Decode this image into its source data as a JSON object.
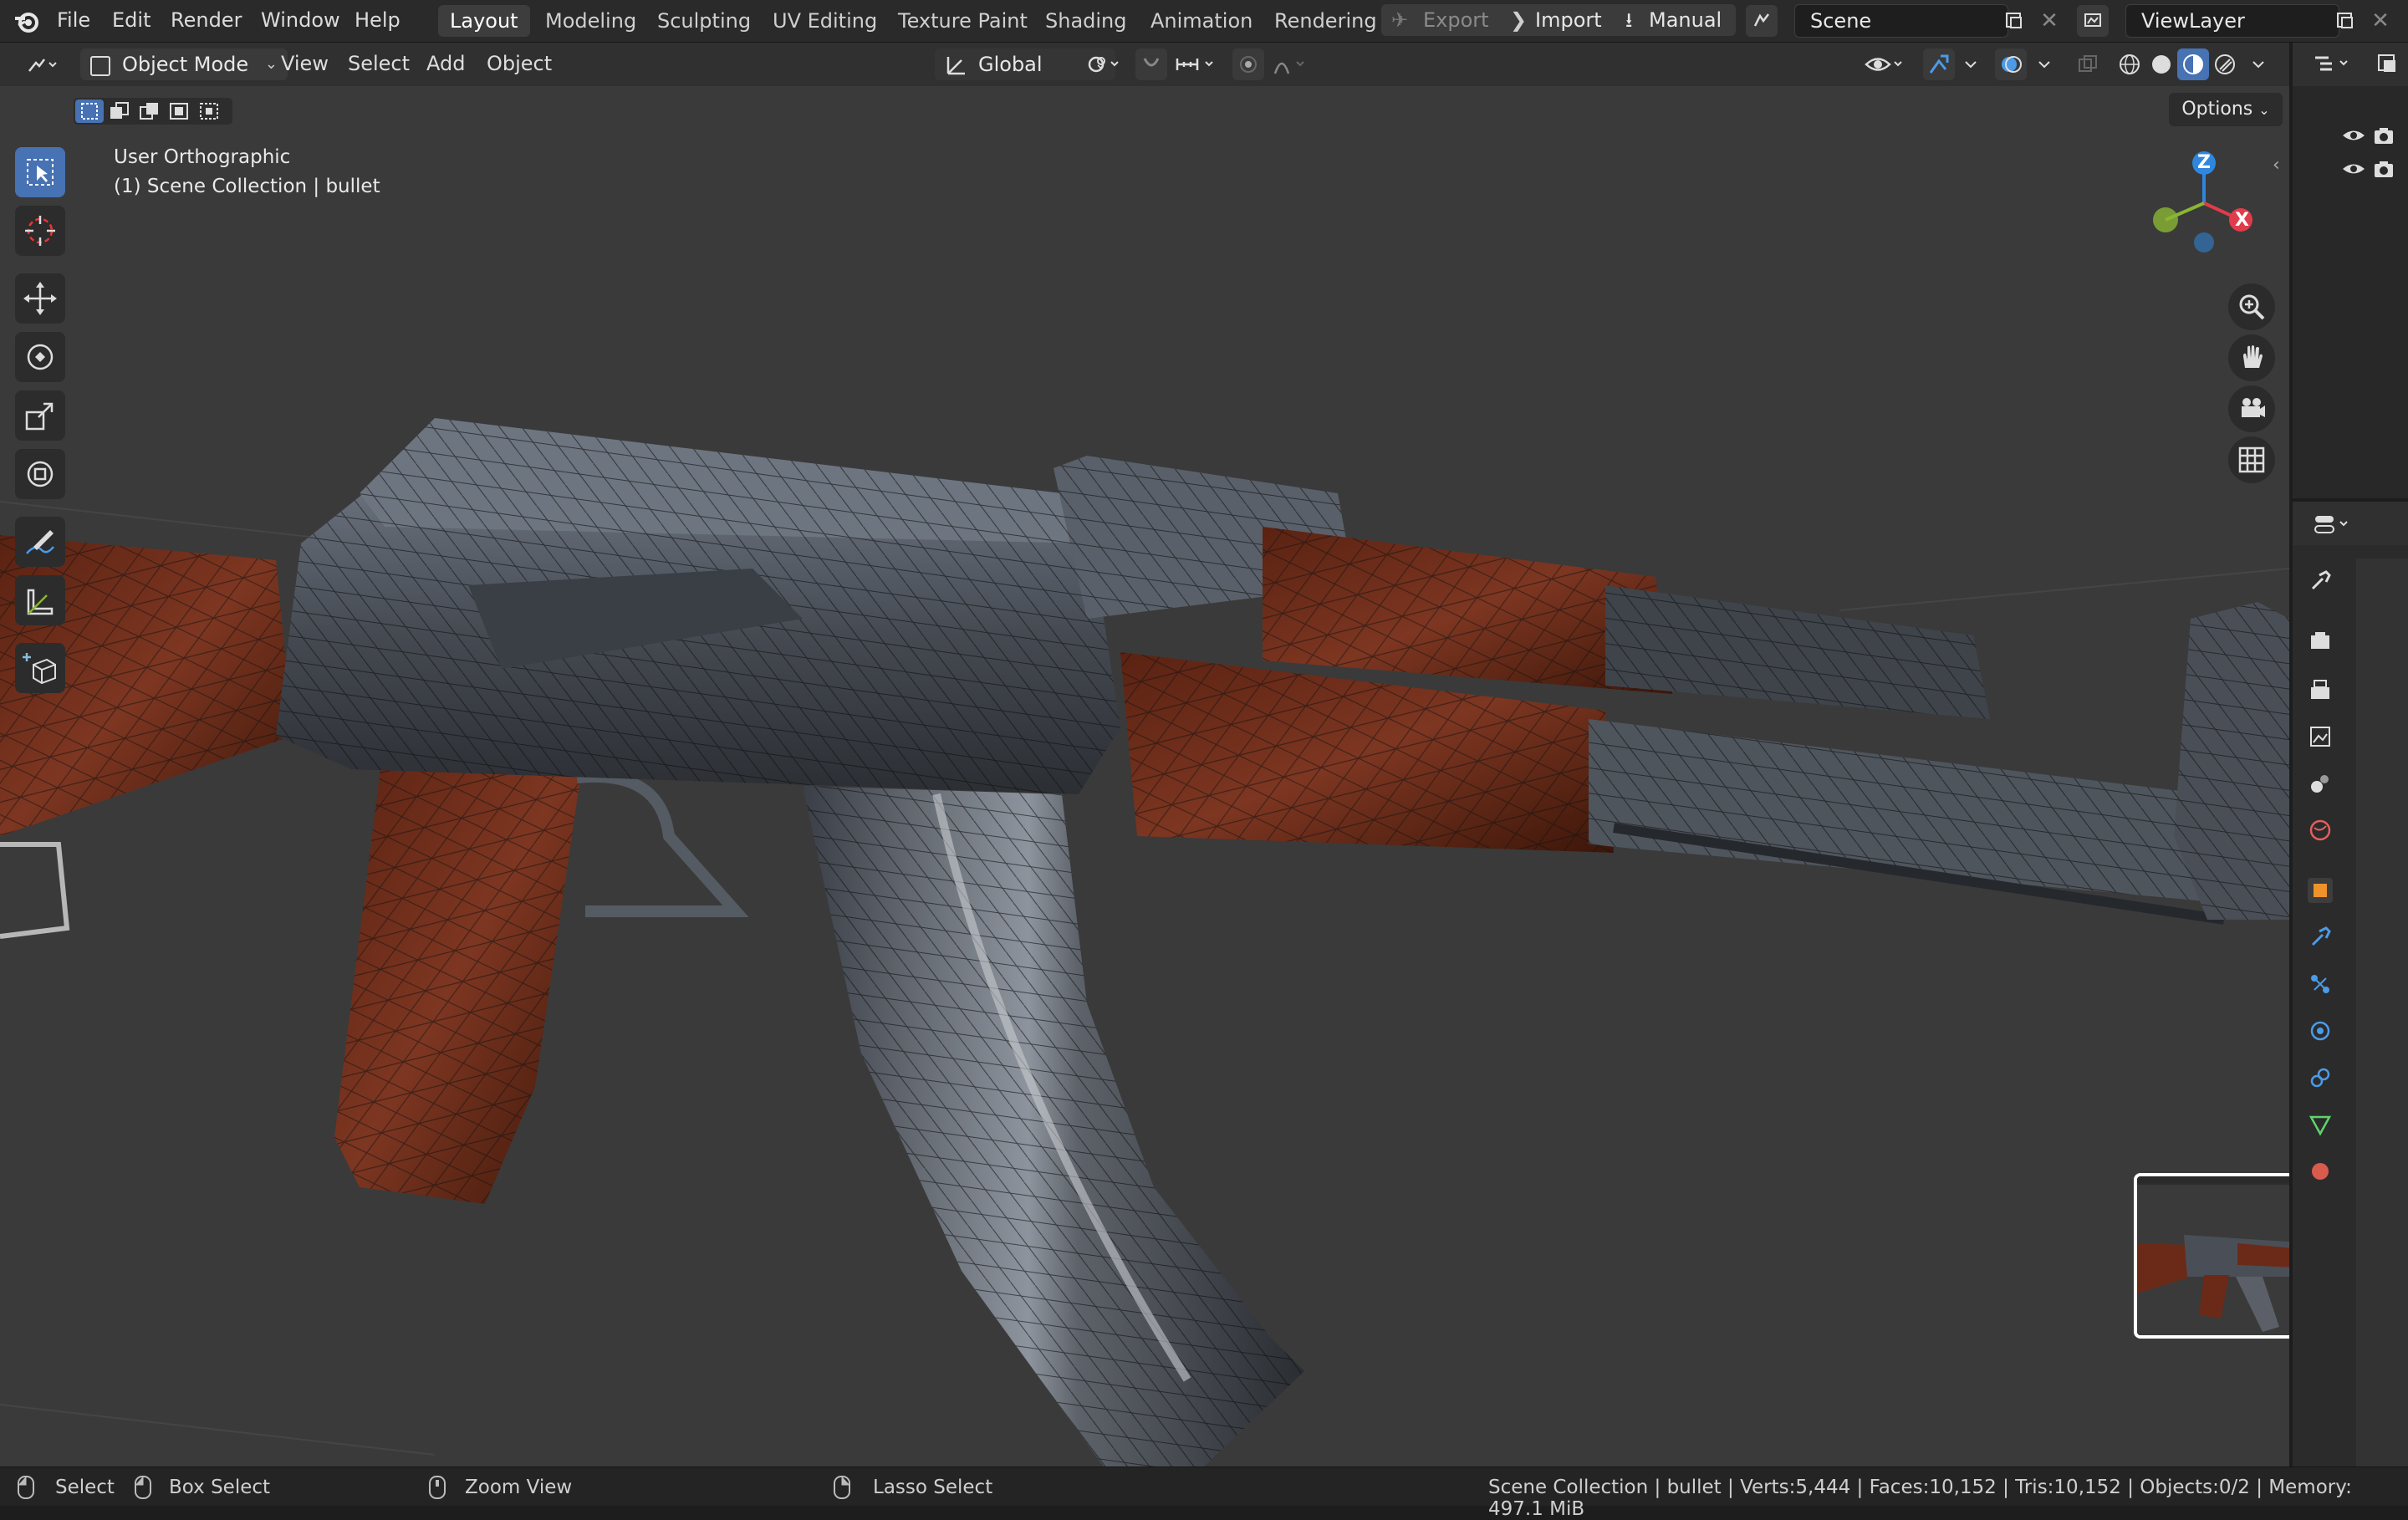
{
  "topbar": {
    "menu": [
      "File",
      "Edit",
      "Render",
      "Window",
      "Help"
    ],
    "workspaces": [
      "Layout",
      "Modeling",
      "Sculpting",
      "UV Editing",
      "Texture Paint",
      "Shading",
      "Animation",
      "Rendering"
    ],
    "active_workspace": "Layout",
    "export_label": "Export",
    "import_label": "Import",
    "manual_label": "Manual",
    "scene_name": "Scene",
    "view_layer": "ViewLayer"
  },
  "view_header": {
    "mode": "Object Mode",
    "menus": [
      "View",
      "Select",
      "Add",
      "Object"
    ],
    "transform_orientation": "Global",
    "options_label": "Options"
  },
  "viewport": {
    "view_name": "User Orthographic",
    "collection_info": "(1) Scene Collection | bullet",
    "gizmo_axes": {
      "z": "Z",
      "x": "X"
    }
  },
  "colors": {
    "accent": "#4772b3",
    "axis_x": "#e03c4b",
    "axis_y": "#8bb534",
    "axis_z": "#2e86de",
    "wood": "#6b2a18",
    "metal": "#4a4f57"
  },
  "statusbar": {
    "select": "Select",
    "box_select": "Box Select",
    "zoom_view": "Zoom View",
    "lasso_select": "Lasso Select",
    "stats": "Scene Collection | bullet | Verts:5,444 | Faces:10,152 | Tris:10,152 | Objects:0/2 | Memory: 497.1 MiB"
  }
}
